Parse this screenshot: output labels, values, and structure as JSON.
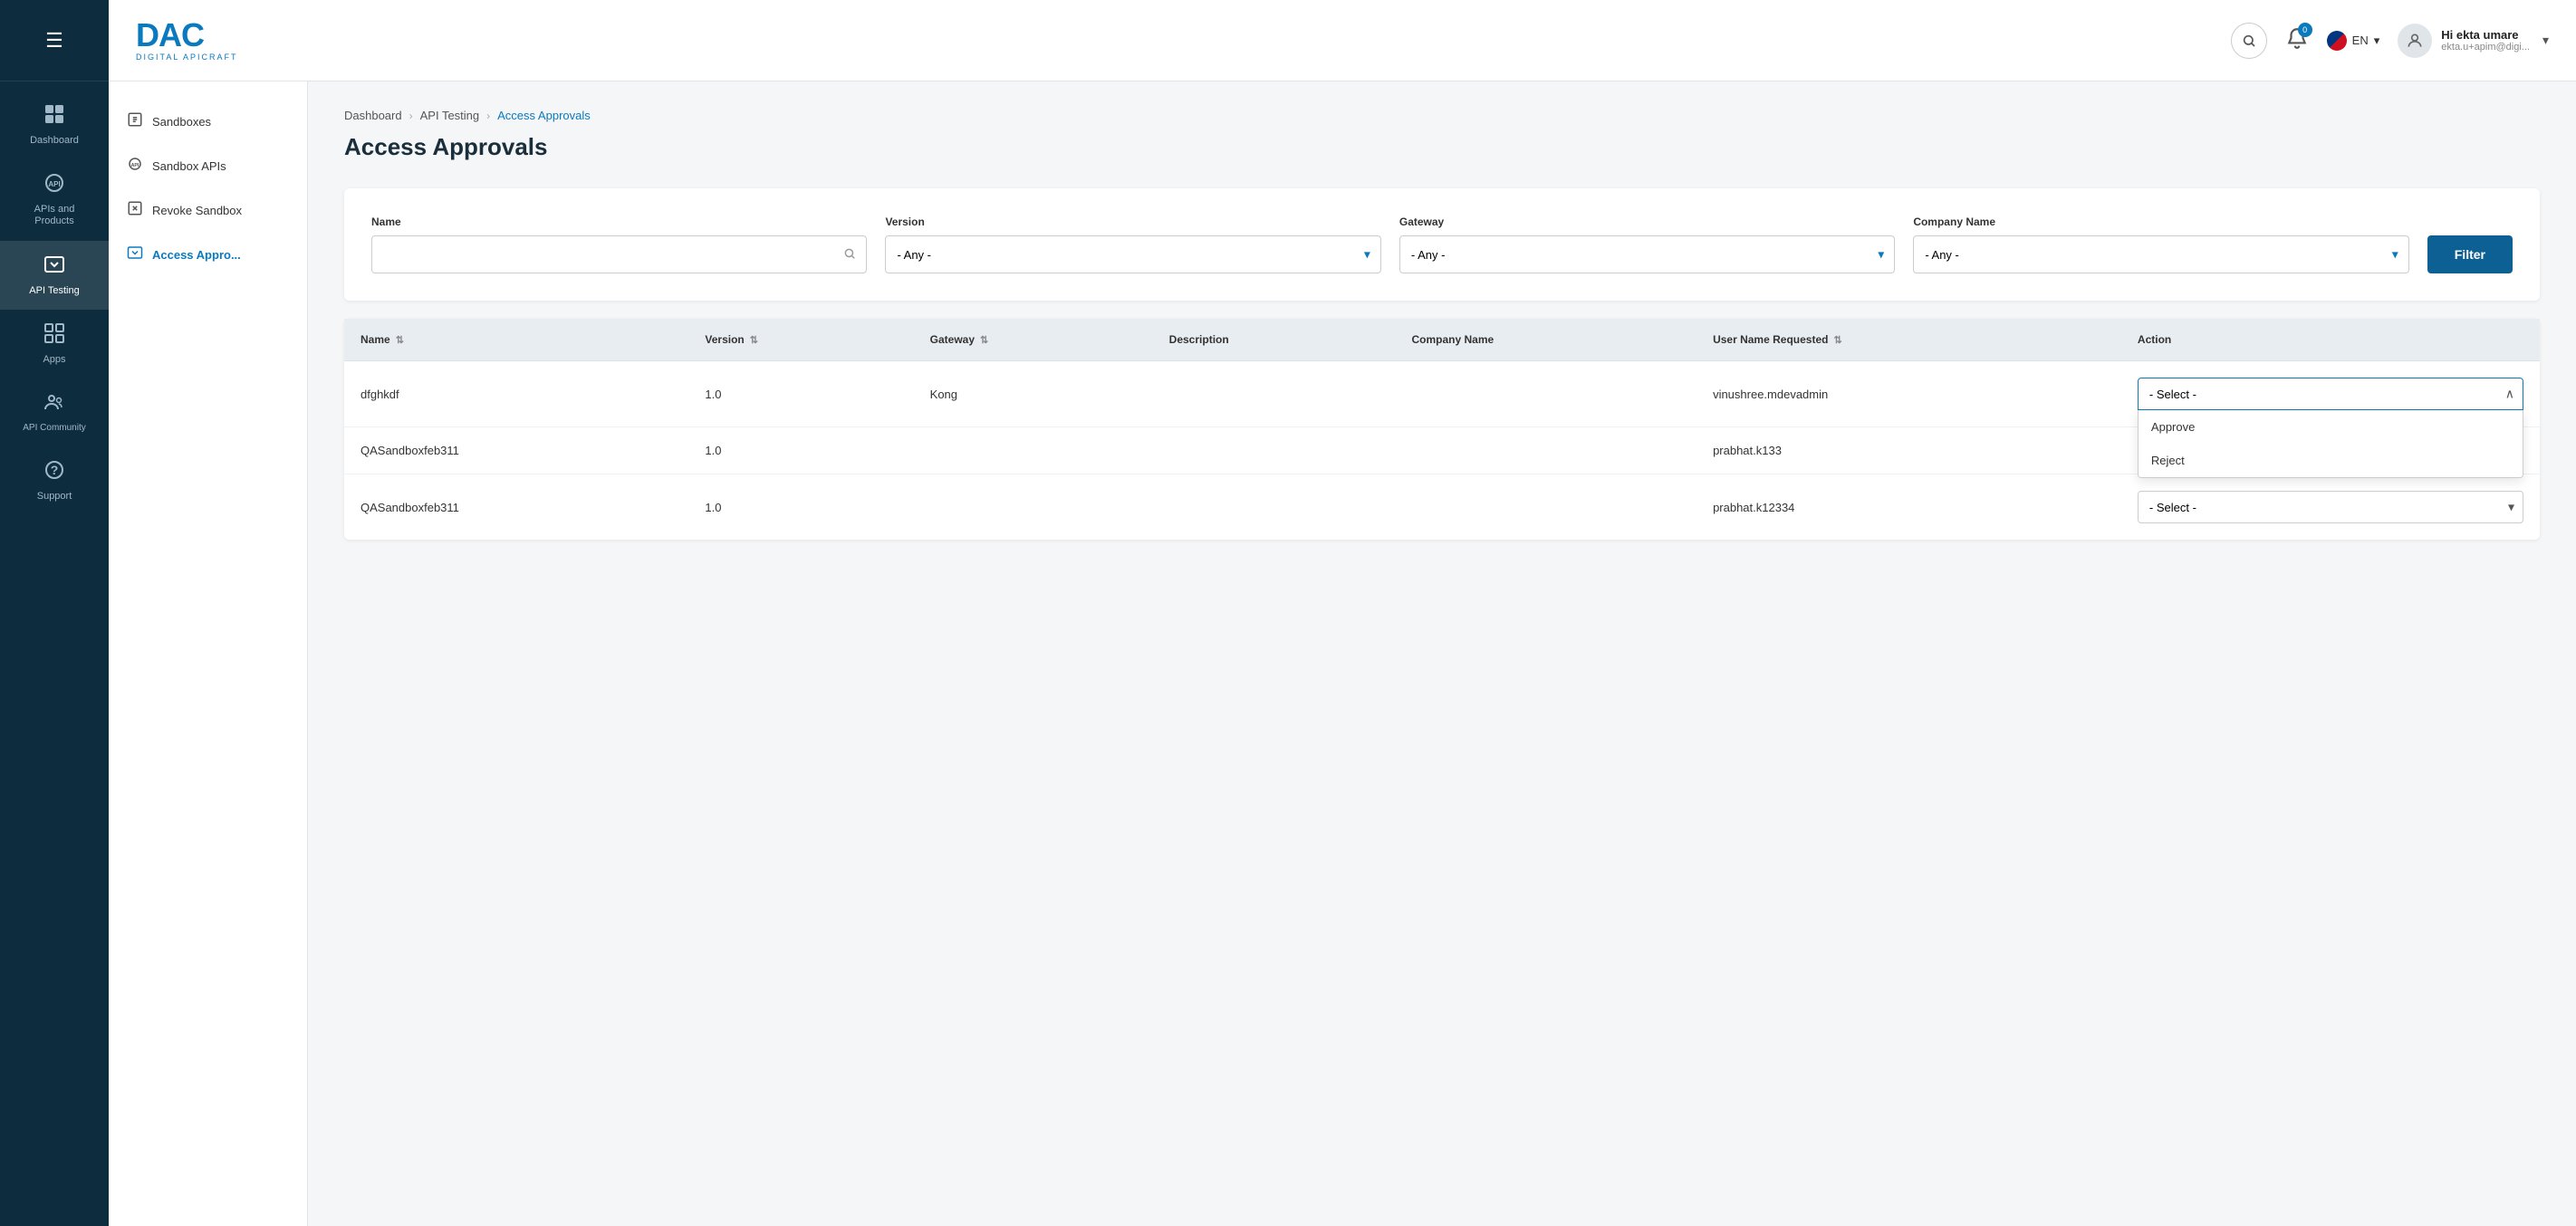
{
  "sidebar": {
    "items": [
      {
        "id": "dashboard",
        "label": "Dashboard",
        "icon": "⊞",
        "active": false
      },
      {
        "id": "apis-products",
        "label": "APIs and\nProducts",
        "icon": "⚙",
        "active": false
      },
      {
        "id": "api-testing",
        "label": "API Testing",
        "icon": "🖥",
        "active": true
      },
      {
        "id": "apps",
        "label": "Apps",
        "icon": "▦",
        "active": false
      },
      {
        "id": "api-community",
        "label": "API Community",
        "icon": "💬",
        "active": false
      },
      {
        "id": "support",
        "label": "Support",
        "icon": "❓",
        "active": false
      }
    ]
  },
  "secondary_sidebar": {
    "items": [
      {
        "id": "sandboxes",
        "label": "Sandboxes",
        "icon": "◫",
        "active": false
      },
      {
        "id": "sandbox-apis",
        "label": "Sandbox APIs",
        "icon": "⚙",
        "active": false
      },
      {
        "id": "revoke-sandbox",
        "label": "Revoke Sandbox",
        "icon": "↩",
        "active": false
      },
      {
        "id": "access-approvals",
        "label": "Access Appro...",
        "icon": "🖥",
        "active": true
      }
    ]
  },
  "header": {
    "logo_dac": "DAC",
    "logo_sub": "DIGITAL APICRAFT",
    "search_title": "Search",
    "notifications_count": "0",
    "lang_code": "EN",
    "user_greeting": "Hi ekta umare",
    "user_email": "ekta.u+apim@digi...",
    "chevron_down": "▾"
  },
  "breadcrumb": {
    "items": [
      {
        "label": "Dashboard",
        "active": false
      },
      {
        "label": "API Testing",
        "active": false
      },
      {
        "label": "Access Approvals",
        "active": true
      }
    ]
  },
  "page_title": "Access Approvals",
  "filters": {
    "name_label": "Name",
    "name_placeholder": "",
    "version_label": "Version",
    "version_value": "- Any -",
    "gateway_label": "Gateway",
    "gateway_value": "- Any -",
    "company_label": "Company Name",
    "company_value": "- Any -",
    "filter_btn": "Filter"
  },
  "table": {
    "columns": [
      {
        "id": "name",
        "label": "Name",
        "sortable": true
      },
      {
        "id": "version",
        "label": "Version",
        "sortable": true
      },
      {
        "id": "gateway",
        "label": "Gateway",
        "sortable": true
      },
      {
        "id": "description",
        "label": "Description",
        "sortable": false
      },
      {
        "id": "company",
        "label": "Company Name",
        "sortable": false
      },
      {
        "id": "user",
        "label": "User Name Requested",
        "sortable": true
      },
      {
        "id": "action",
        "label": "Action",
        "sortable": false
      }
    ],
    "rows": [
      {
        "name": "dfghkdf",
        "version": "1.0",
        "gateway": "Kong",
        "description": "",
        "company": "",
        "user": "vinushree.mdevadmin",
        "action_value": "- Select -",
        "action_open": true
      },
      {
        "name": "QASandboxfeb311",
        "version": "1.0",
        "gateway": "",
        "description": "",
        "company": "",
        "user": "prabhat.k133",
        "action_value": "",
        "action_open": false
      },
      {
        "name": "QASandboxfeb311",
        "version": "1.0",
        "gateway": "",
        "description": "",
        "company": "",
        "user": "prabhat.k12334",
        "action_value": "- Select -",
        "action_open": false
      }
    ],
    "dropdown_options": [
      {
        "label": "Approve",
        "disabled": false
      },
      {
        "label": "Reject",
        "disabled": false
      }
    ]
  },
  "colors": {
    "primary": "#0a7abf",
    "sidebar_bg": "#0d2d3e",
    "active_nav_bg": "rgba(255,255,255,0.12)"
  }
}
